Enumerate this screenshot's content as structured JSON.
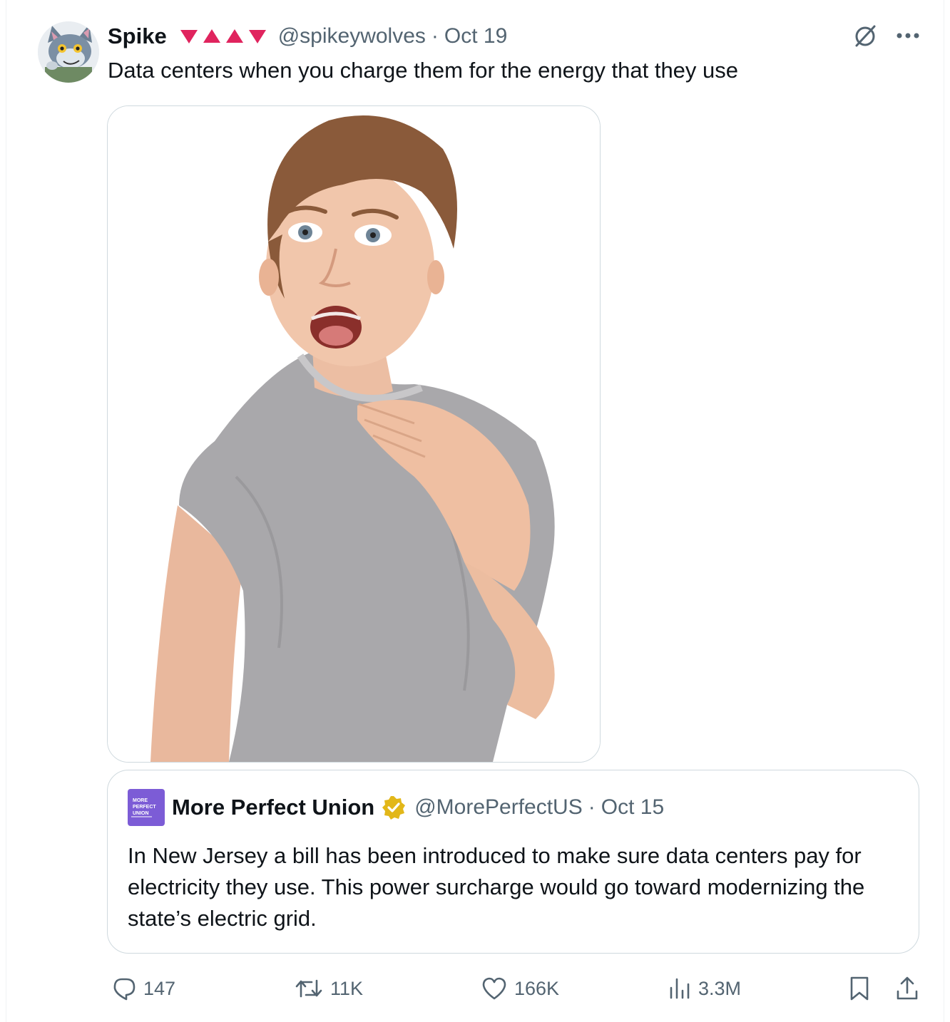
{
  "post": {
    "author": {
      "display_name": "Spike",
      "handle": "@spikeywolves",
      "flair": [
        "down-triangle",
        "up-triangle",
        "up-triangle",
        "down-triangle"
      ],
      "flair_color": "#e0245e"
    },
    "separator": "·",
    "date": "Oct 19",
    "text": "Data centers when you charge them for the energy that they use",
    "icons": {
      "grok": "grok-slash-icon",
      "more": "more-dots-icon"
    }
  },
  "quote": {
    "author": {
      "display_name": "More Perfect Union",
      "handle": "@MorePerfectUS",
      "verified": true,
      "badge_color": "#e2b719",
      "avatar_text": [
        "MORE",
        "PERFECT",
        "UNION"
      ]
    },
    "separator": "·",
    "date": "Oct 15",
    "text": "In New Jersey a bill has been introduced to make sure data centers pay for electricity they use. This power surcharge would go toward modernizing the state’s electric grid."
  },
  "actions": {
    "replies": "147",
    "reposts": "11K",
    "likes": "166K",
    "views": "3.3M"
  },
  "colors": {
    "text": "#0f1419",
    "secondary": "#536471",
    "border": "#cfd9de",
    "avatar_purple": "#7c5cd6"
  }
}
